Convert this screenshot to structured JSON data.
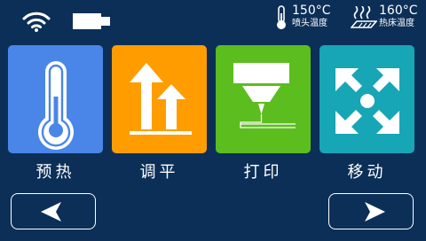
{
  "status_bar": {
    "wifi_icon": "wifi-icon",
    "battery_icon": "battery-icon",
    "nozzle": {
      "icon": "thermometer-icon",
      "value": "150°C",
      "label": "喷头温度"
    },
    "bed": {
      "icon": "heated-bed-icon",
      "value": "160°C",
      "label": "热床温度"
    }
  },
  "menu": [
    {
      "label": "预热",
      "icon": "thermometer-icon",
      "color": "#4a86e8"
    },
    {
      "label": "调平",
      "icon": "leveling-arrows-icon",
      "color": "#ff9d00"
    },
    {
      "label": "打印",
      "icon": "print-nozzle-icon",
      "color": "#5cbd1f"
    },
    {
      "label": "移动",
      "icon": "move-arrows-icon",
      "color": "#16a6b6"
    }
  ],
  "nav": {
    "prev_icon": "arrow-left-icon",
    "next_icon": "arrow-right-icon"
  }
}
